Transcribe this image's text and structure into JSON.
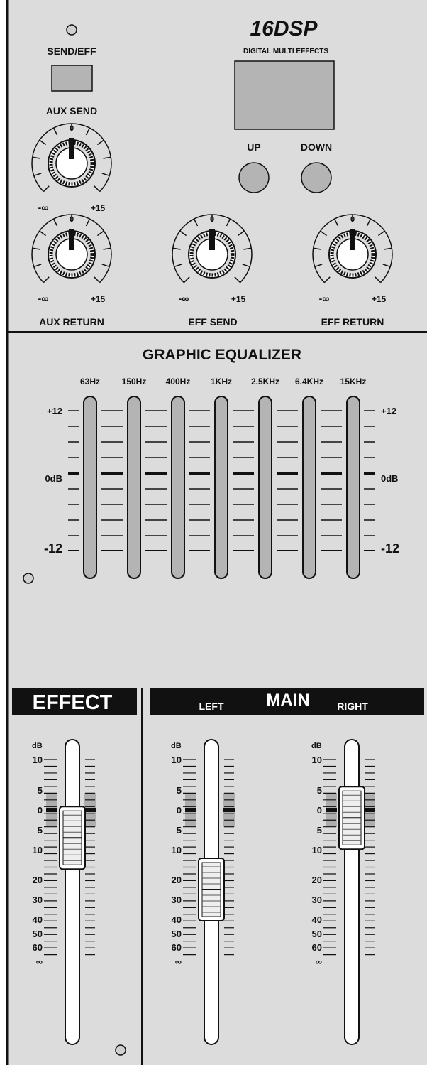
{
  "top": {
    "send_eff_label": "SEND/EFF",
    "aux_send_label": "AUX SEND",
    "dsp_logo": "16DSP",
    "dsp_subtitle": "DIGITAL MULTI EFFECTS",
    "up_label": "UP",
    "down_label": "DOWN"
  },
  "knobs": [
    {
      "label": "",
      "zero": "0",
      "min": "-∞",
      "max": "+15"
    },
    {
      "label": "AUX RETURN",
      "zero": "0",
      "min": "-∞",
      "max": "+15"
    },
    {
      "label": "EFF SEND",
      "zero": "0",
      "min": "-∞",
      "max": "+15"
    },
    {
      "label": "EFF RETURN",
      "zero": "0",
      "min": "-∞",
      "max": "+15"
    }
  ],
  "eq": {
    "title": "GRAPHIC EQUALIZER",
    "bands": [
      "63Hz",
      "150Hz",
      "400Hz",
      "1KHz",
      "2.5KHz",
      "6.4KHz",
      "15KHz"
    ],
    "scale_left": {
      "top": "+12",
      "mid": "0dB",
      "bottom": "-12"
    },
    "scale_right": {
      "top": "+12",
      "mid": "0dB",
      "bottom": "-12"
    }
  },
  "effect_header": "EFFECT",
  "main_header": {
    "left": "LEFT",
    "main": "MAIN",
    "right": "RIGHT"
  },
  "fader_scale": {
    "unit": "dB",
    "labels": [
      "10",
      "5",
      "0",
      "5",
      "10",
      "20",
      "30",
      "40",
      "50",
      "60",
      "∞"
    ]
  },
  "faders": [
    {
      "id": "effect",
      "level_db": "7"
    },
    {
      "id": "left",
      "level_db": "25"
    },
    {
      "id": "right",
      "level_db": "2"
    }
  ],
  "colors": {
    "panel": "#dcdcdc",
    "dark": "#111111",
    "button": "#b4b4b4"
  }
}
